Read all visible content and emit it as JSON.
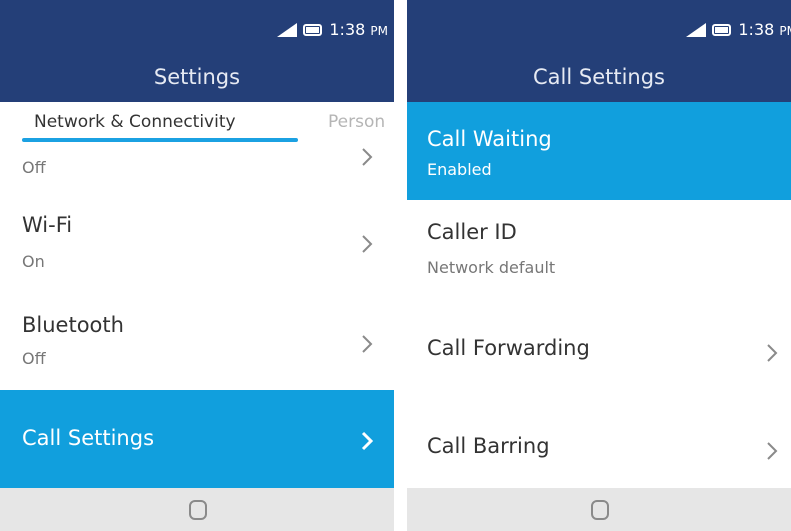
{
  "status": {
    "time": "1:38",
    "ampm": "PM"
  },
  "left": {
    "header_title": "Settings",
    "tabs": [
      {
        "label": "Network & Connectivity"
      },
      {
        "label": "Person"
      }
    ],
    "items": [
      {
        "title": "",
        "subtitle": "Off"
      },
      {
        "title": "Wi-Fi",
        "subtitle": "On"
      },
      {
        "title": "Bluetooth",
        "subtitle": "Off"
      },
      {
        "title": "Call Settings",
        "subtitle": ""
      }
    ]
  },
  "right": {
    "header_title": "Call Settings",
    "items": [
      {
        "title": "Call Waiting",
        "subtitle": "Enabled"
      },
      {
        "title": "Caller ID",
        "subtitle": "Network default"
      },
      {
        "title": "Call Forwarding",
        "subtitle": ""
      },
      {
        "title": "Call Barring",
        "subtitle": ""
      }
    ]
  },
  "colors": {
    "header_bg": "#243f78",
    "accent_selected": "#119fdd",
    "tab_underline": "#1ba1e2",
    "nav_bar_bg": "#e6e6e6"
  }
}
